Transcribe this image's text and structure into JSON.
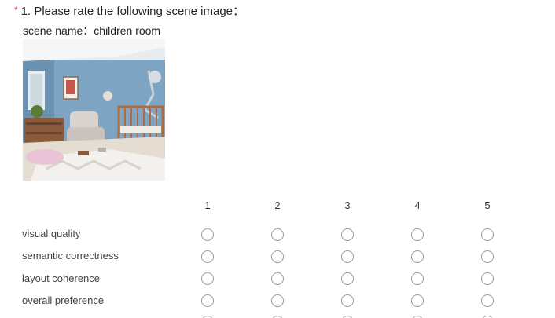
{
  "question": {
    "required_mark": "*",
    "title": "1. Please rate the following scene image：",
    "scene_label": "scene name：",
    "scene_value": "children room"
  },
  "rating_columns": [
    "1",
    "2",
    "3",
    "4",
    "5"
  ],
  "criteria": [
    {
      "label": "visual quality"
    },
    {
      "label": "semantic correctness"
    },
    {
      "label": "layout coherence"
    },
    {
      "label": "overall preference"
    }
  ],
  "colors": {
    "required": "#e04040",
    "radio_border": "#9a9a9a",
    "text": "#222222"
  }
}
